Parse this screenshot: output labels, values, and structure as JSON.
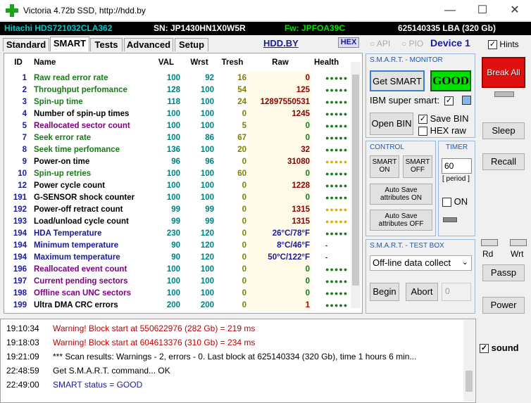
{
  "window": {
    "title": "Victoria 4.72b SSD, http://hdd.by",
    "min": "—",
    "max": "☐",
    "close": "✕"
  },
  "info": {
    "model": "Hitachi HDS721032CLA362",
    "sn": "SN: JP1430HN1X0W5R",
    "fw": "Fw: JPFOA39C",
    "lba": "625140335 LBA (320 Gb)"
  },
  "tabs": [
    "Standard",
    "SMART",
    "Tests",
    "Advanced",
    "Setup"
  ],
  "hddby": "HDD.BY",
  "hex": "HEX",
  "api": "API",
  "pio": "PIO",
  "device": "Device 1",
  "hints": "Hints",
  "table": {
    "headers": [
      "ID",
      "Name",
      "VAL",
      "Wrst",
      "Tresh",
      "Raw",
      "Health"
    ],
    "rows": [
      {
        "id": "1",
        "name": "Raw read error rate",
        "val": "100",
        "wrst": "92",
        "tresh": "16",
        "raw": "0",
        "color": "#1a7a1a",
        "rawcolor": "#8b0000",
        "health": "●●●●●",
        "hcolor": "#1a7a1a"
      },
      {
        "id": "2",
        "name": "Throughput perfomance",
        "val": "128",
        "wrst": "100",
        "tresh": "54",
        "raw": "125",
        "color": "#1a7a1a",
        "rawcolor": "#8b0000",
        "health": "●●●●●",
        "hcolor": "#1a7a1a"
      },
      {
        "id": "3",
        "name": "Spin-up time",
        "val": "118",
        "wrst": "100",
        "tresh": "24",
        "raw": "12897550531",
        "color": "#1a7a1a",
        "rawcolor": "#8b0000",
        "health": "●●●●●",
        "hcolor": "#1a7a1a"
      },
      {
        "id": "4",
        "name": "Number of spin-up times",
        "val": "100",
        "wrst": "100",
        "tresh": "0",
        "raw": "1245",
        "color": "#000",
        "rawcolor": "#8b0000",
        "health": "●●●●●",
        "hcolor": "#1a7a1a"
      },
      {
        "id": "5",
        "name": "Reallocated sector count",
        "val": "100",
        "wrst": "100",
        "tresh": "5",
        "raw": "0",
        "color": "#800080",
        "rawcolor": "#1a7a1a",
        "health": "●●●●●",
        "hcolor": "#1a7a1a"
      },
      {
        "id": "7",
        "name": "Seek error rate",
        "val": "100",
        "wrst": "86",
        "tresh": "67",
        "raw": "0",
        "color": "#1a7a1a",
        "rawcolor": "#1a7a1a",
        "health": "●●●●●",
        "hcolor": "#1a7a1a"
      },
      {
        "id": "8",
        "name": "Seek time perfomance",
        "val": "136",
        "wrst": "100",
        "tresh": "20",
        "raw": "32",
        "color": "#1a7a1a",
        "rawcolor": "#8b0000",
        "health": "●●●●●",
        "hcolor": "#1a7a1a"
      },
      {
        "id": "9",
        "name": "Power-on time",
        "val": "96",
        "wrst": "96",
        "tresh": "0",
        "raw": "31080",
        "color": "#000",
        "rawcolor": "#8b0000",
        "health": "●●●●●",
        "hcolor": "#e0b000"
      },
      {
        "id": "10",
        "name": "Spin-up retries",
        "val": "100",
        "wrst": "100",
        "tresh": "60",
        "raw": "0",
        "color": "#1a7a1a",
        "rawcolor": "#1a7a1a",
        "health": "●●●●●",
        "hcolor": "#1a7a1a"
      },
      {
        "id": "12",
        "name": "Power cycle count",
        "val": "100",
        "wrst": "100",
        "tresh": "0",
        "raw": "1228",
        "color": "#000",
        "rawcolor": "#8b0000",
        "health": "●●●●●",
        "hcolor": "#1a7a1a"
      },
      {
        "id": "191",
        "name": "G-SENSOR shock counter",
        "val": "100",
        "wrst": "100",
        "tresh": "0",
        "raw": "0",
        "color": "#000",
        "rawcolor": "#1a7a1a",
        "health": "●●●●●",
        "hcolor": "#1a7a1a"
      },
      {
        "id": "192",
        "name": "Power-off retract count",
        "val": "99",
        "wrst": "99",
        "tresh": "0",
        "raw": "1315",
        "color": "#000",
        "rawcolor": "#8b0000",
        "health": "●●●●●",
        "hcolor": "#e0b000"
      },
      {
        "id": "193",
        "name": "Load/unload cycle count",
        "val": "99",
        "wrst": "99",
        "tresh": "0",
        "raw": "1315",
        "color": "#000",
        "rawcolor": "#8b0000",
        "health": "●●●●●",
        "hcolor": "#e0b000"
      },
      {
        "id": "194",
        "name": "HDA Temperature",
        "val": "230",
        "wrst": "120",
        "tresh": "0",
        "raw": "26°C/78°F",
        "color": "#1a1aa0",
        "rawcolor": "#1a1aa0",
        "health": "●●●●●",
        "hcolor": "#1a7a1a"
      },
      {
        "id": "194",
        "name": "Minimum temperature",
        "val": "90",
        "wrst": "120",
        "tresh": "0",
        "raw": "8°C/46°F",
        "color": "#1a1aa0",
        "rawcolor": "#1a1aa0",
        "health": "-",
        "hcolor": "#000"
      },
      {
        "id": "194",
        "name": "Maximum temperature",
        "val": "90",
        "wrst": "120",
        "tresh": "0",
        "raw": "50°C/122°F",
        "color": "#1a1aa0",
        "rawcolor": "#1a1aa0",
        "health": "-",
        "hcolor": "#000"
      },
      {
        "id": "196",
        "name": "Reallocated event count",
        "val": "100",
        "wrst": "100",
        "tresh": "0",
        "raw": "0",
        "color": "#800080",
        "rawcolor": "#1a7a1a",
        "health": "●●●●●",
        "hcolor": "#1a7a1a"
      },
      {
        "id": "197",
        "name": "Current pending sectors",
        "val": "100",
        "wrst": "100",
        "tresh": "0",
        "raw": "0",
        "color": "#800080",
        "rawcolor": "#1a7a1a",
        "health": "●●●●●",
        "hcolor": "#1a7a1a"
      },
      {
        "id": "198",
        "name": "Offline scan UNC sectors",
        "val": "100",
        "wrst": "100",
        "tresh": "0",
        "raw": "0",
        "color": "#800080",
        "rawcolor": "#1a7a1a",
        "health": "●●●●●",
        "hcolor": "#1a7a1a"
      },
      {
        "id": "199",
        "name": "Ultra DMA CRC errors",
        "val": "200",
        "wrst": "200",
        "tresh": "0",
        "raw": "1",
        "color": "#000",
        "rawcolor": "#c00000",
        "health": "●●●●●",
        "hcolor": "#1a7a1a"
      }
    ]
  },
  "monitor": {
    "title": "S.M.A.R.T. - MONITOR",
    "get": "Get SMART",
    "status": "GOOD",
    "ibm": "IBM super smart:",
    "open": "Open BIN",
    "save": "Save BIN",
    "hexraw": "HEX raw"
  },
  "control": {
    "title": "CONTROL",
    "on": "SMART ON",
    "off": "SMART OFF",
    "auto_on": "Auto Save attributes ON",
    "auto_off": "Auto Save attributes OFF"
  },
  "timer": {
    "title": "TIMER",
    "value": "60",
    "period": "[ period ]",
    "on": "ON"
  },
  "testbox": {
    "title": "S.M.A.R.T. - TEST BOX",
    "select": "Off-line data collect",
    "begin": "Begin",
    "abort": "Abort",
    "num": "0"
  },
  "right": {
    "break": "Break All",
    "sleep": "Sleep",
    "recall": "Recall",
    "rd": "Rd",
    "wrt": "Wrt",
    "passp": "Passp",
    "power": "Power",
    "sound": "sound"
  },
  "log": [
    {
      "t": "19:10:34",
      "m": "Warning! Block start at 550622976 (282 Gb)  = 219 ms",
      "c": "#c00000"
    },
    {
      "t": "19:18:03",
      "m": "Warning! Block start at 604613376 (310 Gb)  = 234 ms",
      "c": "#c00000"
    },
    {
      "t": "19:21:09",
      "m": "*** Scan results: Warnings - 2, errors - 0. Last block at 625140334 (320 Gb), time 1 hours 6 min...",
      "c": "#000"
    },
    {
      "t": "22:48:59",
      "m": "Get S.M.A.R.T. command... OK",
      "c": "#000"
    },
    {
      "t": "22:49:00",
      "m": "SMART status = GOOD",
      "c": "#1a1aa0"
    }
  ]
}
